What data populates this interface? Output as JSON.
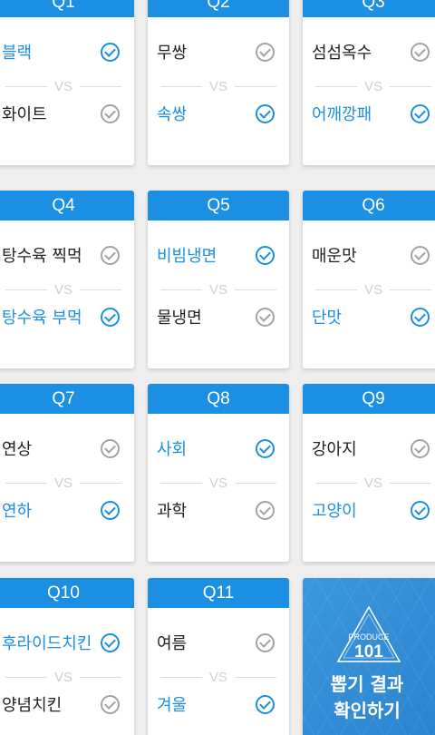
{
  "vs_label": "VS",
  "questions": [
    {
      "label": "Q1",
      "top": {
        "text": "블랙",
        "selected": true
      },
      "bottom": {
        "text": "화이트",
        "selected": false
      }
    },
    {
      "label": "Q2",
      "top": {
        "text": "무쌍",
        "selected": false
      },
      "bottom": {
        "text": "속쌍",
        "selected": true
      }
    },
    {
      "label": "Q3",
      "top": {
        "text": "섬섬옥수",
        "selected": false
      },
      "bottom": {
        "text": "어깨깡패",
        "selected": true
      }
    },
    {
      "label": "Q4",
      "top": {
        "text": "탕수육 찍먹",
        "selected": false
      },
      "bottom": {
        "text": "탕수육 부먹",
        "selected": true
      }
    },
    {
      "label": "Q5",
      "top": {
        "text": "비빔냉면",
        "selected": true
      },
      "bottom": {
        "text": "물냉면",
        "selected": false
      }
    },
    {
      "label": "Q6",
      "top": {
        "text": "매운맛",
        "selected": false
      },
      "bottom": {
        "text": "단맛",
        "selected": true
      }
    },
    {
      "label": "Q7",
      "top": {
        "text": "연상",
        "selected": false
      },
      "bottom": {
        "text": "연하",
        "selected": true
      }
    },
    {
      "label": "Q8",
      "top": {
        "text": "사회",
        "selected": true
      },
      "bottom": {
        "text": "과학",
        "selected": false
      }
    },
    {
      "label": "Q9",
      "top": {
        "text": "강아지",
        "selected": false
      },
      "bottom": {
        "text": "고양이",
        "selected": true
      }
    },
    {
      "label": "Q10",
      "top": {
        "text": "후라이드치킨",
        "selected": true
      },
      "bottom": {
        "text": "양념치킨",
        "selected": false
      }
    },
    {
      "label": "Q11",
      "top": {
        "text": "여름",
        "selected": false
      },
      "bottom": {
        "text": "겨울",
        "selected": true
      }
    }
  ],
  "result": {
    "logo_top": "PRODUCE",
    "logo_number": "101",
    "line1": "뽑기 결과",
    "line2": "확인하기"
  },
  "colors": {
    "accent": "#1a8fe3",
    "unselected_check": "#a3a3a3",
    "background": "#eeeeef"
  }
}
